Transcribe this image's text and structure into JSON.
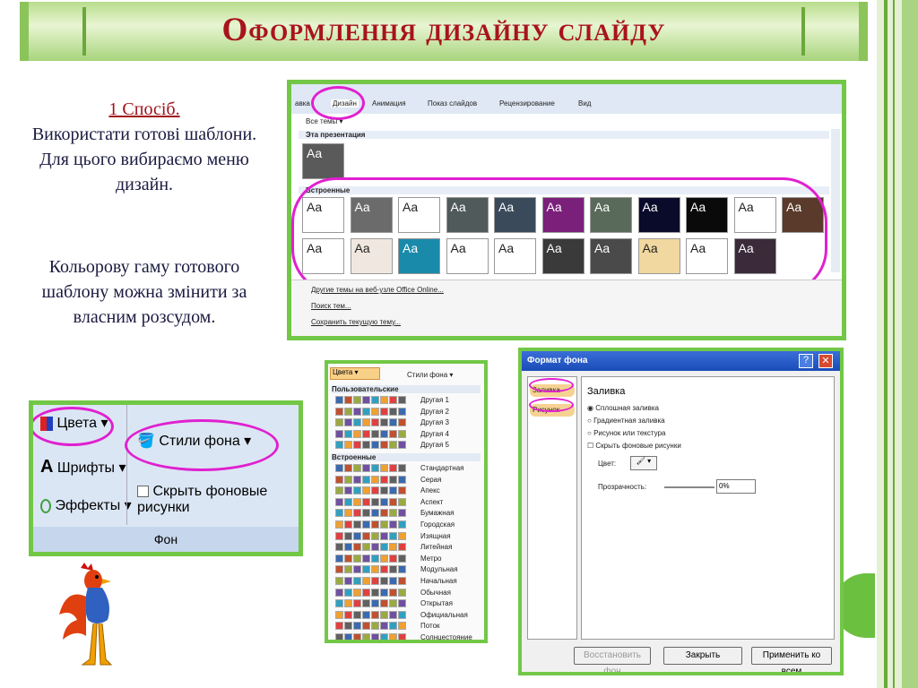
{
  "slide": {
    "title": "Оформлення дизайну слайду",
    "left_heading": "1 Спосіб.",
    "left_text": "Використати готові шаблони. Для цього вибираємо меню дизайн.",
    "left_text2": "Кольорову гаму готового шаблону можна змінити за власним розсудом."
  },
  "ribbon_tabs": [
    "авка",
    "Дизайн",
    "Анимация",
    "Показ слайдов",
    "Рецензирование",
    "Вид"
  ],
  "themes": {
    "all_label": "Все темы ▾",
    "this_label": "Эта презентация",
    "builtin_label": "Встроенные",
    "swatch_text": "Aa",
    "menu": [
      "Другие темы на веб-узле Office Online...",
      "Поиск тем...",
      "Сохранить текущую тему..."
    ]
  },
  "fon_panel": {
    "colors": "Цвета ▾",
    "fonts": "Шрифты ▾",
    "effects": "Эффекты ▾",
    "styles": "Стили фона ▾",
    "hide": "Скрыть фоновые рисунки",
    "group": "Фон"
  },
  "colors_menu": {
    "btn": "Цвета ▾",
    "btn2": "Стили фона ▾",
    "user_header": "Пользовательские",
    "user": [
      "Другая 1",
      "Другая 2",
      "Другая 3",
      "Другая 4",
      "Другая 5"
    ],
    "builtin_header": "Встроенные",
    "builtin": [
      "Стандартная",
      "Серая",
      "Апекс",
      "Аспект",
      "Бумажная",
      "Городская",
      "Изящная",
      "Литейная",
      "Метро",
      "Модульная",
      "Начальная",
      "Обычная",
      "Открытая",
      "Официальная",
      "Поток",
      "Солнцестояние"
    ]
  },
  "dialog": {
    "title": "Формат фона",
    "side": [
      "Заливка",
      "Рисунок"
    ],
    "heading": "Заливка",
    "options": [
      "Сплошная заливка",
      "Градиентная заливка",
      "Рисунок или текстура"
    ],
    "hide": "Скрыть фоновые рисунки",
    "color": "Цвет:",
    "transparency": "Прозрачность:",
    "trans_value": "0%",
    "btn_restore": "Восстановить фон",
    "btn_close": "Закрыть",
    "btn_apply": "Применить ко всем"
  }
}
